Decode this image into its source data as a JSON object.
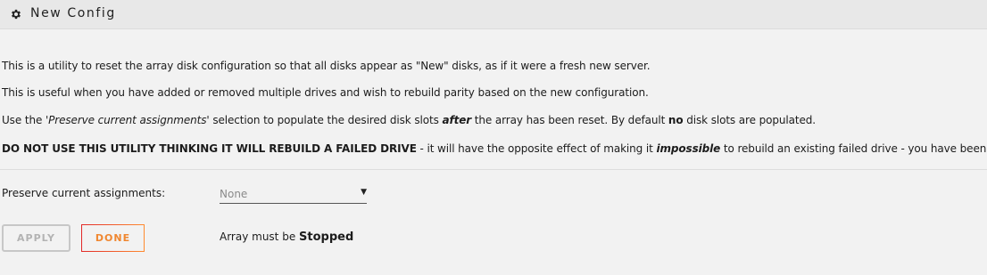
{
  "header": {
    "title": "New Config",
    "icon": "gear-icon"
  },
  "description": {
    "p1": "This is a utility to reset the array disk configuration so that all disks appear as \"New\" disks, as if it were a fresh new server.",
    "p2": "This is useful when you have added or removed multiple drives and wish to rebuild parity based on the new configuration.",
    "p3": {
      "a": "Use the ",
      "b": "'Preserve current assignments'",
      "c": " selection to populate the desired disk slots ",
      "d": "after",
      "e": " the array has been reset. By default ",
      "f": "no",
      "g": " disk slots are populated."
    },
    "p4": {
      "a": "DO NOT USE THIS UTILITY THINKING IT WILL REBUILD A FAILED DRIVE",
      "b": " - it will have the opposite effect of making it ",
      "c": "impossible",
      "d": " to rebuild an existing failed drive - you have been warned!"
    }
  },
  "preserve": {
    "label": "Preserve current assignments:",
    "selected": "None",
    "caret": "▼"
  },
  "buttons": {
    "apply_label": "APPLY",
    "done_label": "DONE"
  },
  "status": {
    "prefix": "Array must be ",
    "state": "Stopped"
  },
  "colors": {
    "accent_orange": "#f08730",
    "accent_red": "#e22828",
    "disabled": "#b3b3b3",
    "background": "#f2f2f2"
  }
}
